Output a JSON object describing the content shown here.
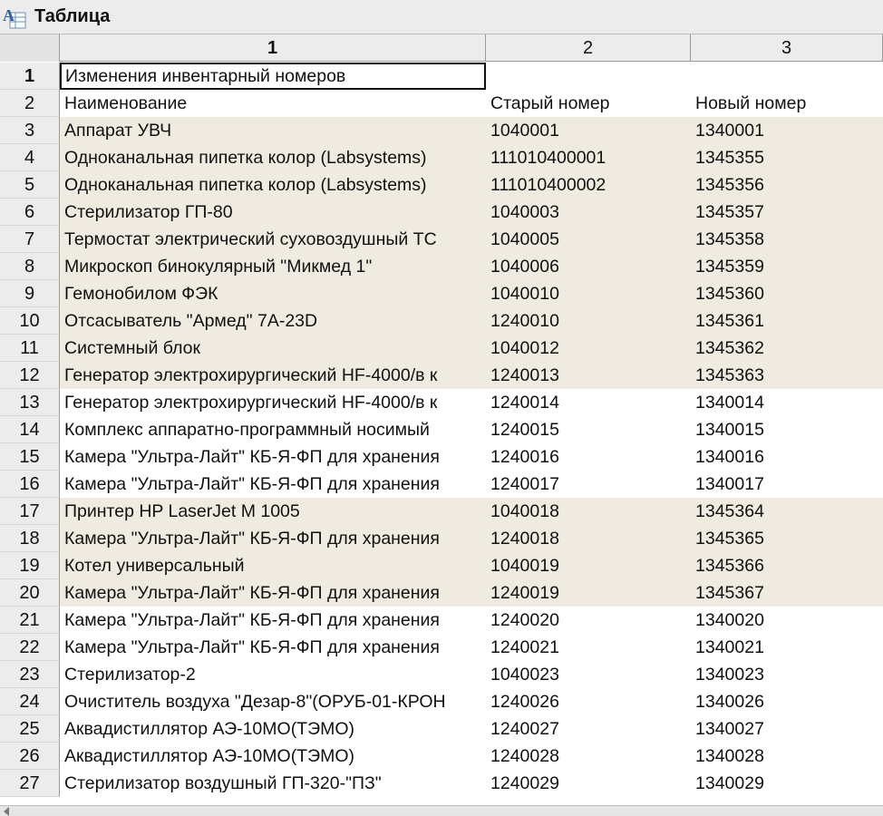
{
  "window": {
    "title": "Таблица",
    "icon": "table-app-icon"
  },
  "columns": [
    "1",
    "2",
    "3"
  ],
  "rows": [
    {
      "num": "1",
      "name": "Изменения инвентарный номеров",
      "old": "",
      "new": "",
      "hl": false
    },
    {
      "num": "2",
      "name": "Наименование",
      "old": "Старый номер",
      "new": "Новый номер",
      "hl": false
    },
    {
      "num": "3",
      "name": "Аппарат УВЧ",
      "old": "1040001",
      "new": "1340001",
      "hl": true
    },
    {
      "num": "4",
      "name": "Одноканальная пипетка колор (Labsystems)",
      "old": "111010400001",
      "new": "1345355",
      "hl": true
    },
    {
      "num": "5",
      "name": "Одноканальная пипетка колор (Labsystems)",
      "old": "111010400002",
      "new": "1345356",
      "hl": true
    },
    {
      "num": "6",
      "name": "Стерилизатор ГП-80",
      "old": "1040003",
      "new": "1345357",
      "hl": true
    },
    {
      "num": "7",
      "name": "Термостат электрический суховоздушный ТС",
      "old": "1040005",
      "new": "1345358",
      "hl": true
    },
    {
      "num": "8",
      "name": "Микроскоп бинокулярный \"Микмед 1\"",
      "old": "1040006",
      "new": "1345359",
      "hl": true
    },
    {
      "num": "9",
      "name": "Гемонобилом ФЭК",
      "old": "1040010",
      "new": "1345360",
      "hl": true
    },
    {
      "num": "10",
      "name": "Отсасыватель \"Армед\" 7А-23D",
      "old": "1240010",
      "new": "1345361",
      "hl": true
    },
    {
      "num": "11",
      "name": "Системный блок",
      "old": "1040012",
      "new": "1345362",
      "hl": true
    },
    {
      "num": "12",
      "name": "Генератор электрохирургический HF-4000/в к",
      "old": "1240013",
      "new": "1345363",
      "hl": true
    },
    {
      "num": "13",
      "name": "Генератор электрохирургический HF-4000/в к",
      "old": "1240014",
      "new": "1340014",
      "hl": false
    },
    {
      "num": "14",
      "name": "Комплекс аппаратно-программный носимый",
      "old": "1240015",
      "new": "1340015",
      "hl": false
    },
    {
      "num": "15",
      "name": "Камера \"Ультра-Лайт\" КБ-Я-ФП для хранения",
      "old": "1240016",
      "new": "1340016",
      "hl": false
    },
    {
      "num": "16",
      "name": "Камера \"Ультра-Лайт\" КБ-Я-ФП для хранения",
      "old": "1240017",
      "new": "1340017",
      "hl": false
    },
    {
      "num": "17",
      "name": "Принтер HP LaserJet M 1005",
      "old": "1040018",
      "new": "1345364",
      "hl": true
    },
    {
      "num": "18",
      "name": "Камера \"Ультра-Лайт\" КБ-Я-ФП для хранения",
      "old": "1240018",
      "new": "1345365",
      "hl": true
    },
    {
      "num": "19",
      "name": "Котел универсальный",
      "old": "1040019",
      "new": "1345366",
      "hl": true
    },
    {
      "num": "20",
      "name": "Камера \"Ультра-Лайт\" КБ-Я-ФП для хранения",
      "old": "1240019",
      "new": "1345367",
      "hl": true
    },
    {
      "num": "21",
      "name": "Камера \"Ультра-Лайт\" КБ-Я-ФП для хранения",
      "old": "1240020",
      "new": "1340020",
      "hl": false
    },
    {
      "num": "22",
      "name": "Камера \"Ультра-Лайт\" КБ-Я-ФП для хранения",
      "old": "1240021",
      "new": "1340021",
      "hl": false
    },
    {
      "num": "23",
      "name": "Стерилизатор-2",
      "old": "1040023",
      "new": "1340023",
      "hl": false
    },
    {
      "num": "24",
      "name": "Очиститель воздуха \"Дезар-8\"(ОРУБ-01-КРОН",
      "old": "1240026",
      "new": "1340026",
      "hl": false
    },
    {
      "num": "25",
      "name": "Аквадистиллятор АЭ-10МО(ТЭМО)",
      "old": "1240027",
      "new": "1340027",
      "hl": false
    },
    {
      "num": "26",
      "name": "Аквадистиллятор АЭ-10МО(ТЭМО)",
      "old": "1240028",
      "new": "1340028",
      "hl": false
    },
    {
      "num": "27",
      "name": "Стерилизатор воздушный ГП-320-\"ПЗ\"",
      "old": "1240029",
      "new": "1340029",
      "hl": false
    }
  ],
  "colors": {
    "highlight": "#efebe0",
    "header_bg": "#ececec",
    "grid": "#9a9a9a"
  }
}
